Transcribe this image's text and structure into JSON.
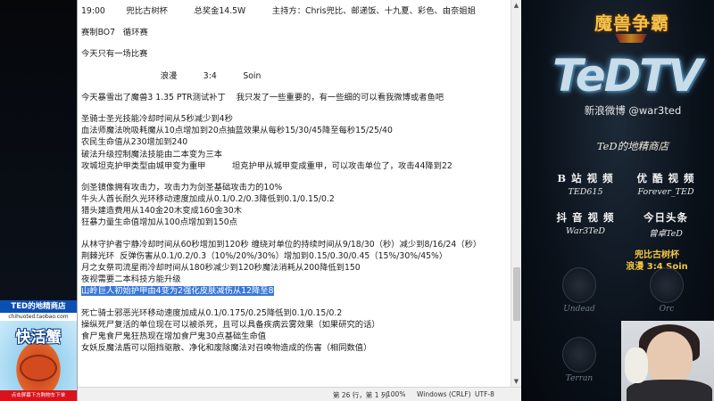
{
  "notepad": {
    "lines": [
      {
        "text": "19:00        兜比古树杯          总奖金14.5W          主持方：Chris兜比、邮递饭、十九夏、彩色、由奈姐姐"
      },
      {
        "text": ""
      },
      {
        "text": "赛制BO7   循环赛"
      },
      {
        "text": ""
      },
      {
        "text": "今天只有一场比赛"
      },
      {
        "text": ""
      },
      {
        "text": "                              浪漫          3:4          Soin"
      },
      {
        "text": ""
      },
      {
        "text": "今天暴雪出了魔兽3 1.35 PTR测试补丁    我只发了一些重要的，有一些细的可以看我微博或者鱼吧"
      },
      {
        "text": ""
      },
      {
        "text": "圣骑士圣光技能冷却时间从5秒减少到4秒"
      },
      {
        "text": "血法师魔法吮吸耗魔从10点增加到20点抽蓝效果从每秒15/30/45降至每秒15/25/40"
      },
      {
        "text": "农民生命值从230增加到240"
      },
      {
        "text": "破法升级控制魔法技能由二本变为三本"
      },
      {
        "text": "攻城坦克护甲类型由城甲变为重甲          坦克护甲从城甲变成重甲，可以攻击单位了，攻击44降到22"
      },
      {
        "text": ""
      },
      {
        "text": "剑圣镜像拥有攻击力，攻击力为剑圣基础攻击力的10%"
      },
      {
        "text": "牛头人酋长耐久光环移动速度加成从0.1/0.2/0.3降低到0.1/0.15/0.2"
      },
      {
        "text": "猎头建造费用从140金20木变成160金30木"
      },
      {
        "text": "狂暴力量生命值增加从100点增加到150点"
      },
      {
        "text": ""
      },
      {
        "text": "从林守护者宁静冷却时间从60秒增加到120秒 缠绕对单位的持续时间从9/18/30（秒）减少到8/16/24（秒）"
      },
      {
        "text": "荆棘光环  反弹伤害从0.1/0.2/0.3（10%/20%/30%）增加到0.15/0.30/0.45（15%/30%/45%）"
      },
      {
        "text": "月之女祭司流星雨冷却时间从180秒减少到120秒魔法消耗从200降低到150"
      },
      {
        "text": "夜视需要二本科技方能升级"
      },
      {
        "text": "山岭巨人初始护甲由4变为2强化皮肤减伤从12降至8",
        "selected": true
      },
      {
        "text": ""
      },
      {
        "text": "死亡骑士邪恶光环移动速度加成从0.1/0.175/0.25降低到0.1/0.15/0.2"
      },
      {
        "text": "操纵死尸复活的单位现在可以被杀死，且可以具备疾病云雾效果（如果研究的话）"
      },
      {
        "text": "食尸鬼食尸鬼狂热现在增加食尸鬼30点基础生命值"
      },
      {
        "text": "女妖反魔法盾可以阻挡驱散、净化和废除魔法对召唤物造成的伤害（相同数值）"
      }
    ],
    "status": {
      "position": "第 26 行，第 1 列",
      "zoom": "100%",
      "eol": "Windows (CRLF)",
      "encoding": "UTF-8"
    }
  },
  "overlay": {
    "brand_cn": "魔兽争霸",
    "logo": "TeDTV",
    "weibo": "新浪微博 @war3ted",
    "shop_title": "TeD的地精商店",
    "socials": [
      {
        "title": "B 站 视 频",
        "handle": "TED615"
      },
      {
        "title": "优 酷 视 频",
        "handle": "Forever_TED"
      },
      {
        "title": "抖 音 视 频",
        "handle": "War3TeD"
      },
      {
        "title": "今日头条",
        "handle": "曾卓TeD"
      }
    ],
    "match": {
      "line1": "兜比古树杯",
      "line2": "浪漫 3:4 Soin"
    },
    "races": [
      {
        "label": "Undead",
        "icon": "undead-emblem"
      },
      {
        "label": "Orc",
        "icon": "orc-emblem"
      },
      {
        "label": "Terran",
        "icon": "terran-emblem"
      }
    ]
  },
  "ad": {
    "title": "TED的地精商店",
    "url": "chihuoted.taobao.com",
    "brand": "快活蟹",
    "footer": "点击屏幕下方购物车下单"
  },
  "colors": {
    "selection": "#3a78d6",
    "accent_gold": "#f4c640",
    "ad_blue": "#0c4fb3"
  }
}
